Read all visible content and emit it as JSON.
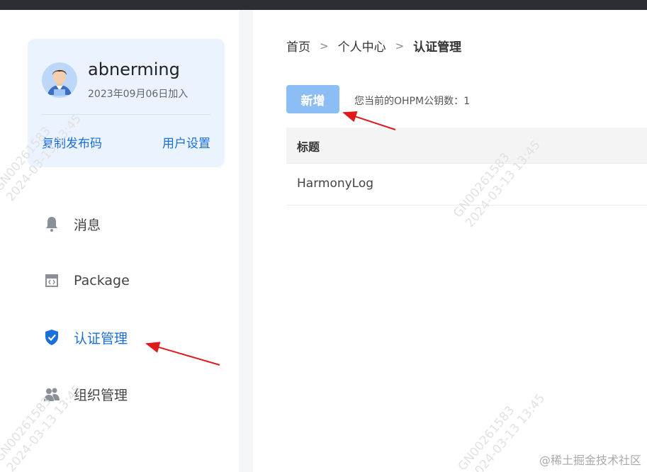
{
  "profile": {
    "username": "abnerming",
    "joined": "2023年09月06日加入",
    "copy_link": "复制发布码",
    "settings_link": "用户设置"
  },
  "nav": {
    "items": [
      {
        "label": "消息",
        "icon": "bell-icon"
      },
      {
        "label": "Package",
        "icon": "package-icon"
      },
      {
        "label": "认证管理",
        "icon": "shield-check-icon",
        "active": true
      },
      {
        "label": "组织管理",
        "icon": "users-icon"
      }
    ]
  },
  "breadcrumb": {
    "home": "首页",
    "separator": ">",
    "personal": "个人中心",
    "current": "认证管理"
  },
  "toolbar": {
    "add_label": "新增",
    "key_count": "您当前的OHPM公钥数：1"
  },
  "table": {
    "headers": [
      "标题"
    ],
    "rows": [
      [
        "HarmonyLog"
      ]
    ]
  },
  "watermark": {
    "line1": "GN00261583",
    "line2": "2024-03-13 13:45"
  },
  "site_mark": "@稀土掘金技术社区",
  "colors": {
    "accent": "#1b6fd9",
    "button": "#8dbdf5",
    "card_bg": "#eaf3ff",
    "annotation_arrow": "#e01a1a"
  }
}
